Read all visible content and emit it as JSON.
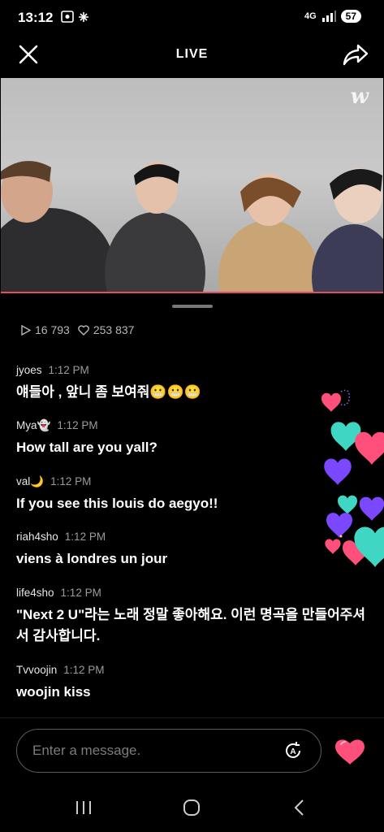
{
  "status_bar": {
    "time": "13:12",
    "network": "4G",
    "battery": "57"
  },
  "header": {
    "title": "LIVE",
    "close_icon": "close-icon",
    "share_icon": "share-icon"
  },
  "video": {
    "logo": "w"
  },
  "stats": {
    "plays": "16 793",
    "likes": "253 837"
  },
  "chat": {
    "messages": [
      {
        "user": "jyoes",
        "time": "1:12 PM",
        "text": "얘들아 , 앞니 좀 보여줘😬😬😬"
      },
      {
        "user": "Mya👻",
        "time": "1:12 PM",
        "text": "How tall are you yall?"
      },
      {
        "user": "val🌙",
        "time": "1:12 PM",
        "text": "If you see this louis do aegyo!!"
      },
      {
        "user": "riah4sho",
        "time": "1:12 PM",
        "text": "viens à londres un jour"
      },
      {
        "user": "life4sho",
        "time": "1:12 PM",
        "text": "\"Next 2 U\"라는 노래 정말 좋아해요. 이런 명곡을 만들어주셔서 감사합니다."
      },
      {
        "user": "Tvvoojin",
        "time": "1:12 PM",
        "text": "woojin kiss"
      }
    ]
  },
  "composer": {
    "placeholder": "Enter a message."
  },
  "colors": {
    "accent": "#e34d5f",
    "heart_pink": "#ff4f7b",
    "heart_teal": "#3fd6c4",
    "heart_purple": "#7b47ff"
  }
}
